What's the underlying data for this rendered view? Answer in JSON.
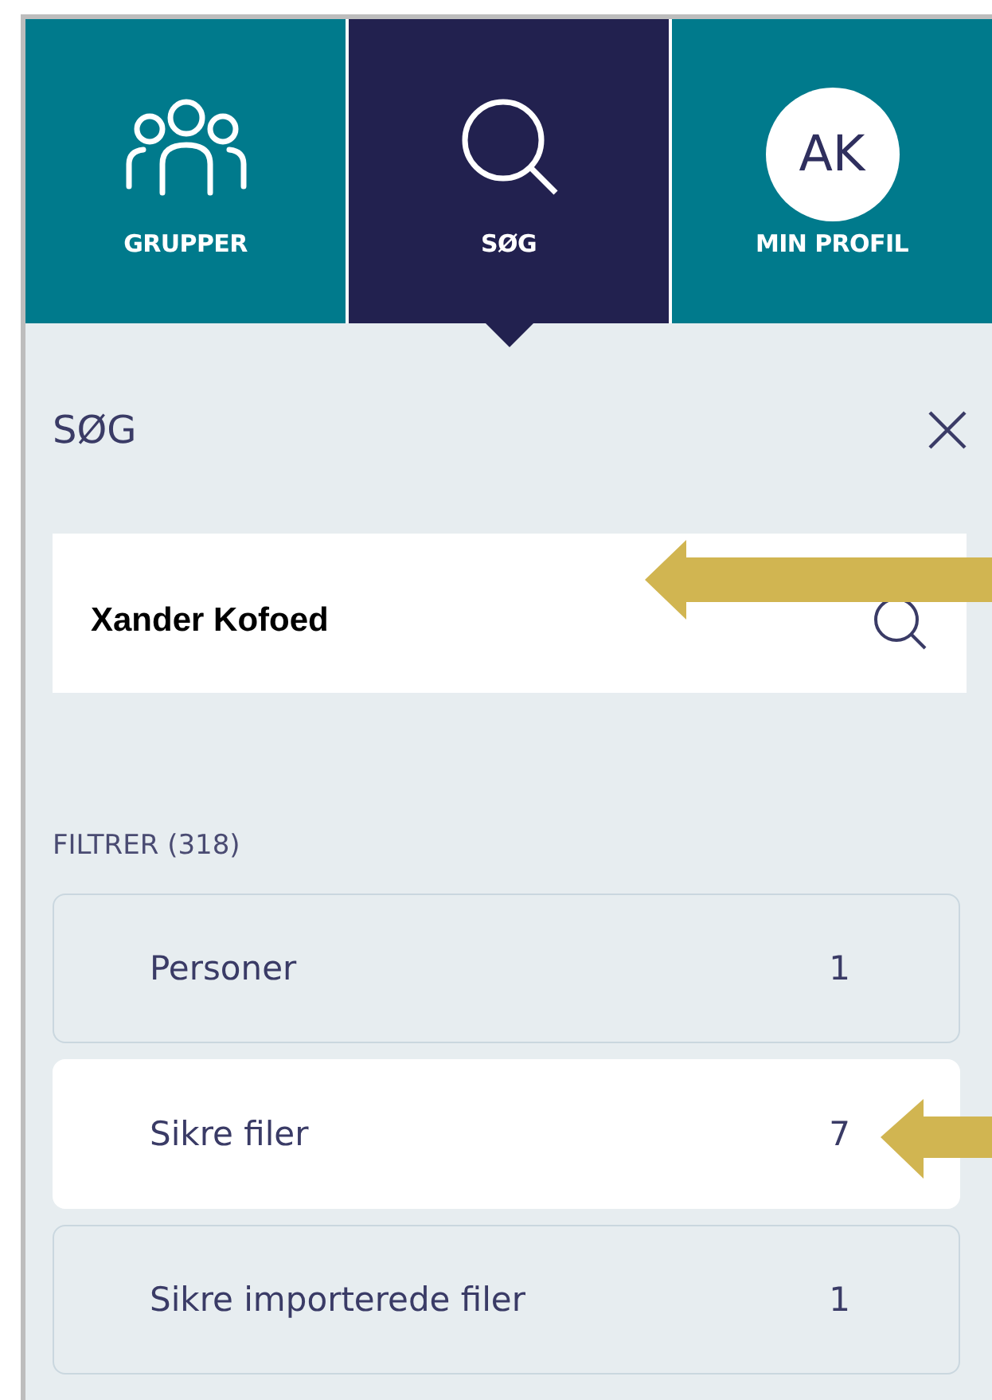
{
  "tabs": [
    {
      "kind": "groups",
      "label": "GRUPPER",
      "selected": false
    },
    {
      "kind": "search",
      "label": "SØG",
      "selected": true
    },
    {
      "kind": "profile",
      "label": "MIN PROFIL",
      "initials": "AK",
      "selected": false
    }
  ],
  "panel": {
    "title": "SØG",
    "search": {
      "value": "Xander Kofoed"
    },
    "filter_label": "FILTRER (318)",
    "filters": [
      {
        "label": "Personer",
        "count": "1",
        "selected": false
      },
      {
        "label": "Sikre filer",
        "count": "7",
        "selected": true
      },
      {
        "label": "Sikre importerede filer",
        "count": "1",
        "selected": false
      }
    ]
  }
}
